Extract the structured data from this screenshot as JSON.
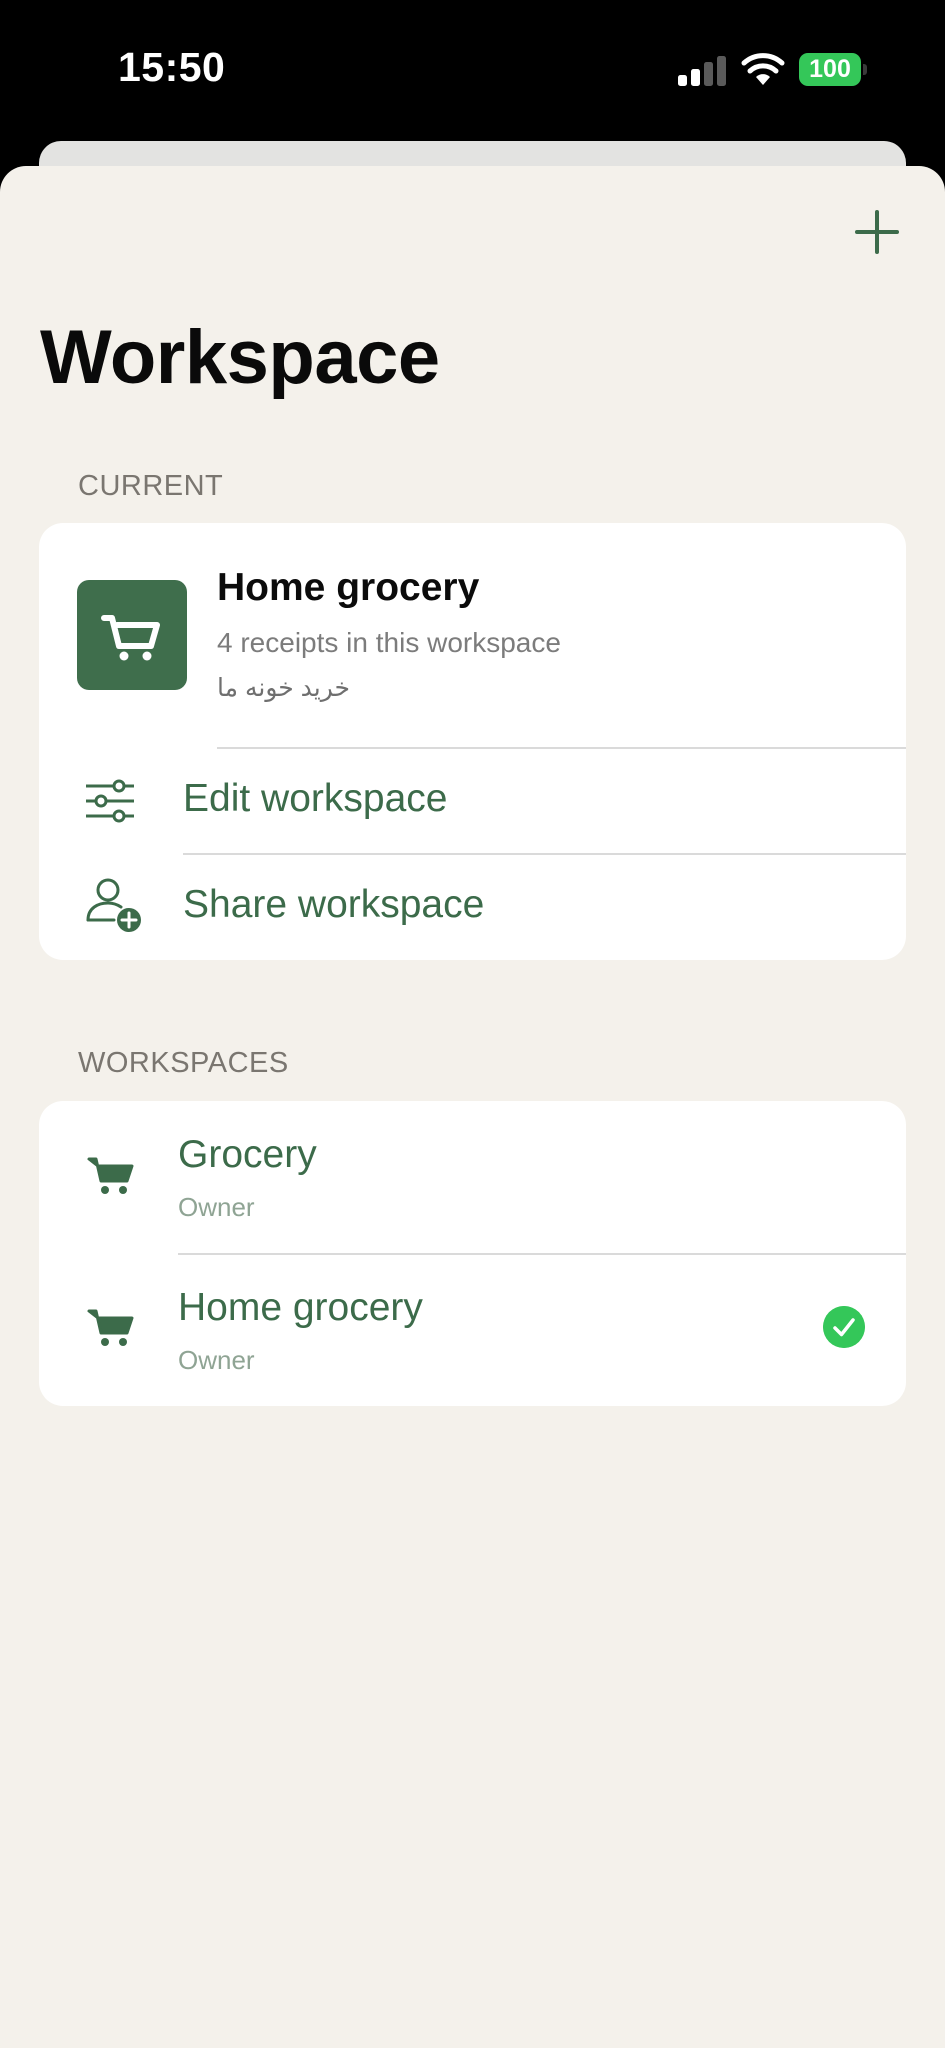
{
  "status_bar": {
    "time": "15:50",
    "battery": "100",
    "battery_color": "#34c759"
  },
  "header": {
    "add_icon": "plus-icon",
    "title": "Workspace"
  },
  "current": {
    "section_label": "CURRENT",
    "workspace": {
      "icon": "shopping-cart-icon",
      "name": "Home grocery",
      "receipts": "4 receipts in this workspace",
      "description": "خرید خونه ما"
    },
    "actions": [
      {
        "icon": "sliders-icon",
        "label": "Edit workspace"
      },
      {
        "icon": "add-person-icon",
        "label": "Share workspace"
      }
    ]
  },
  "workspaces": {
    "section_label": "WORKSPACES",
    "items": [
      {
        "icon": "shopping-cart-icon",
        "name": "Grocery",
        "role": "Owner",
        "selected": false
      },
      {
        "icon": "shopping-cart-icon",
        "name": "Home grocery",
        "role": "Owner",
        "selected": true
      }
    ]
  },
  "colors": {
    "accent": "#3c6b4a",
    "background": "#f4f1eb",
    "selected_check": "#34c759"
  }
}
